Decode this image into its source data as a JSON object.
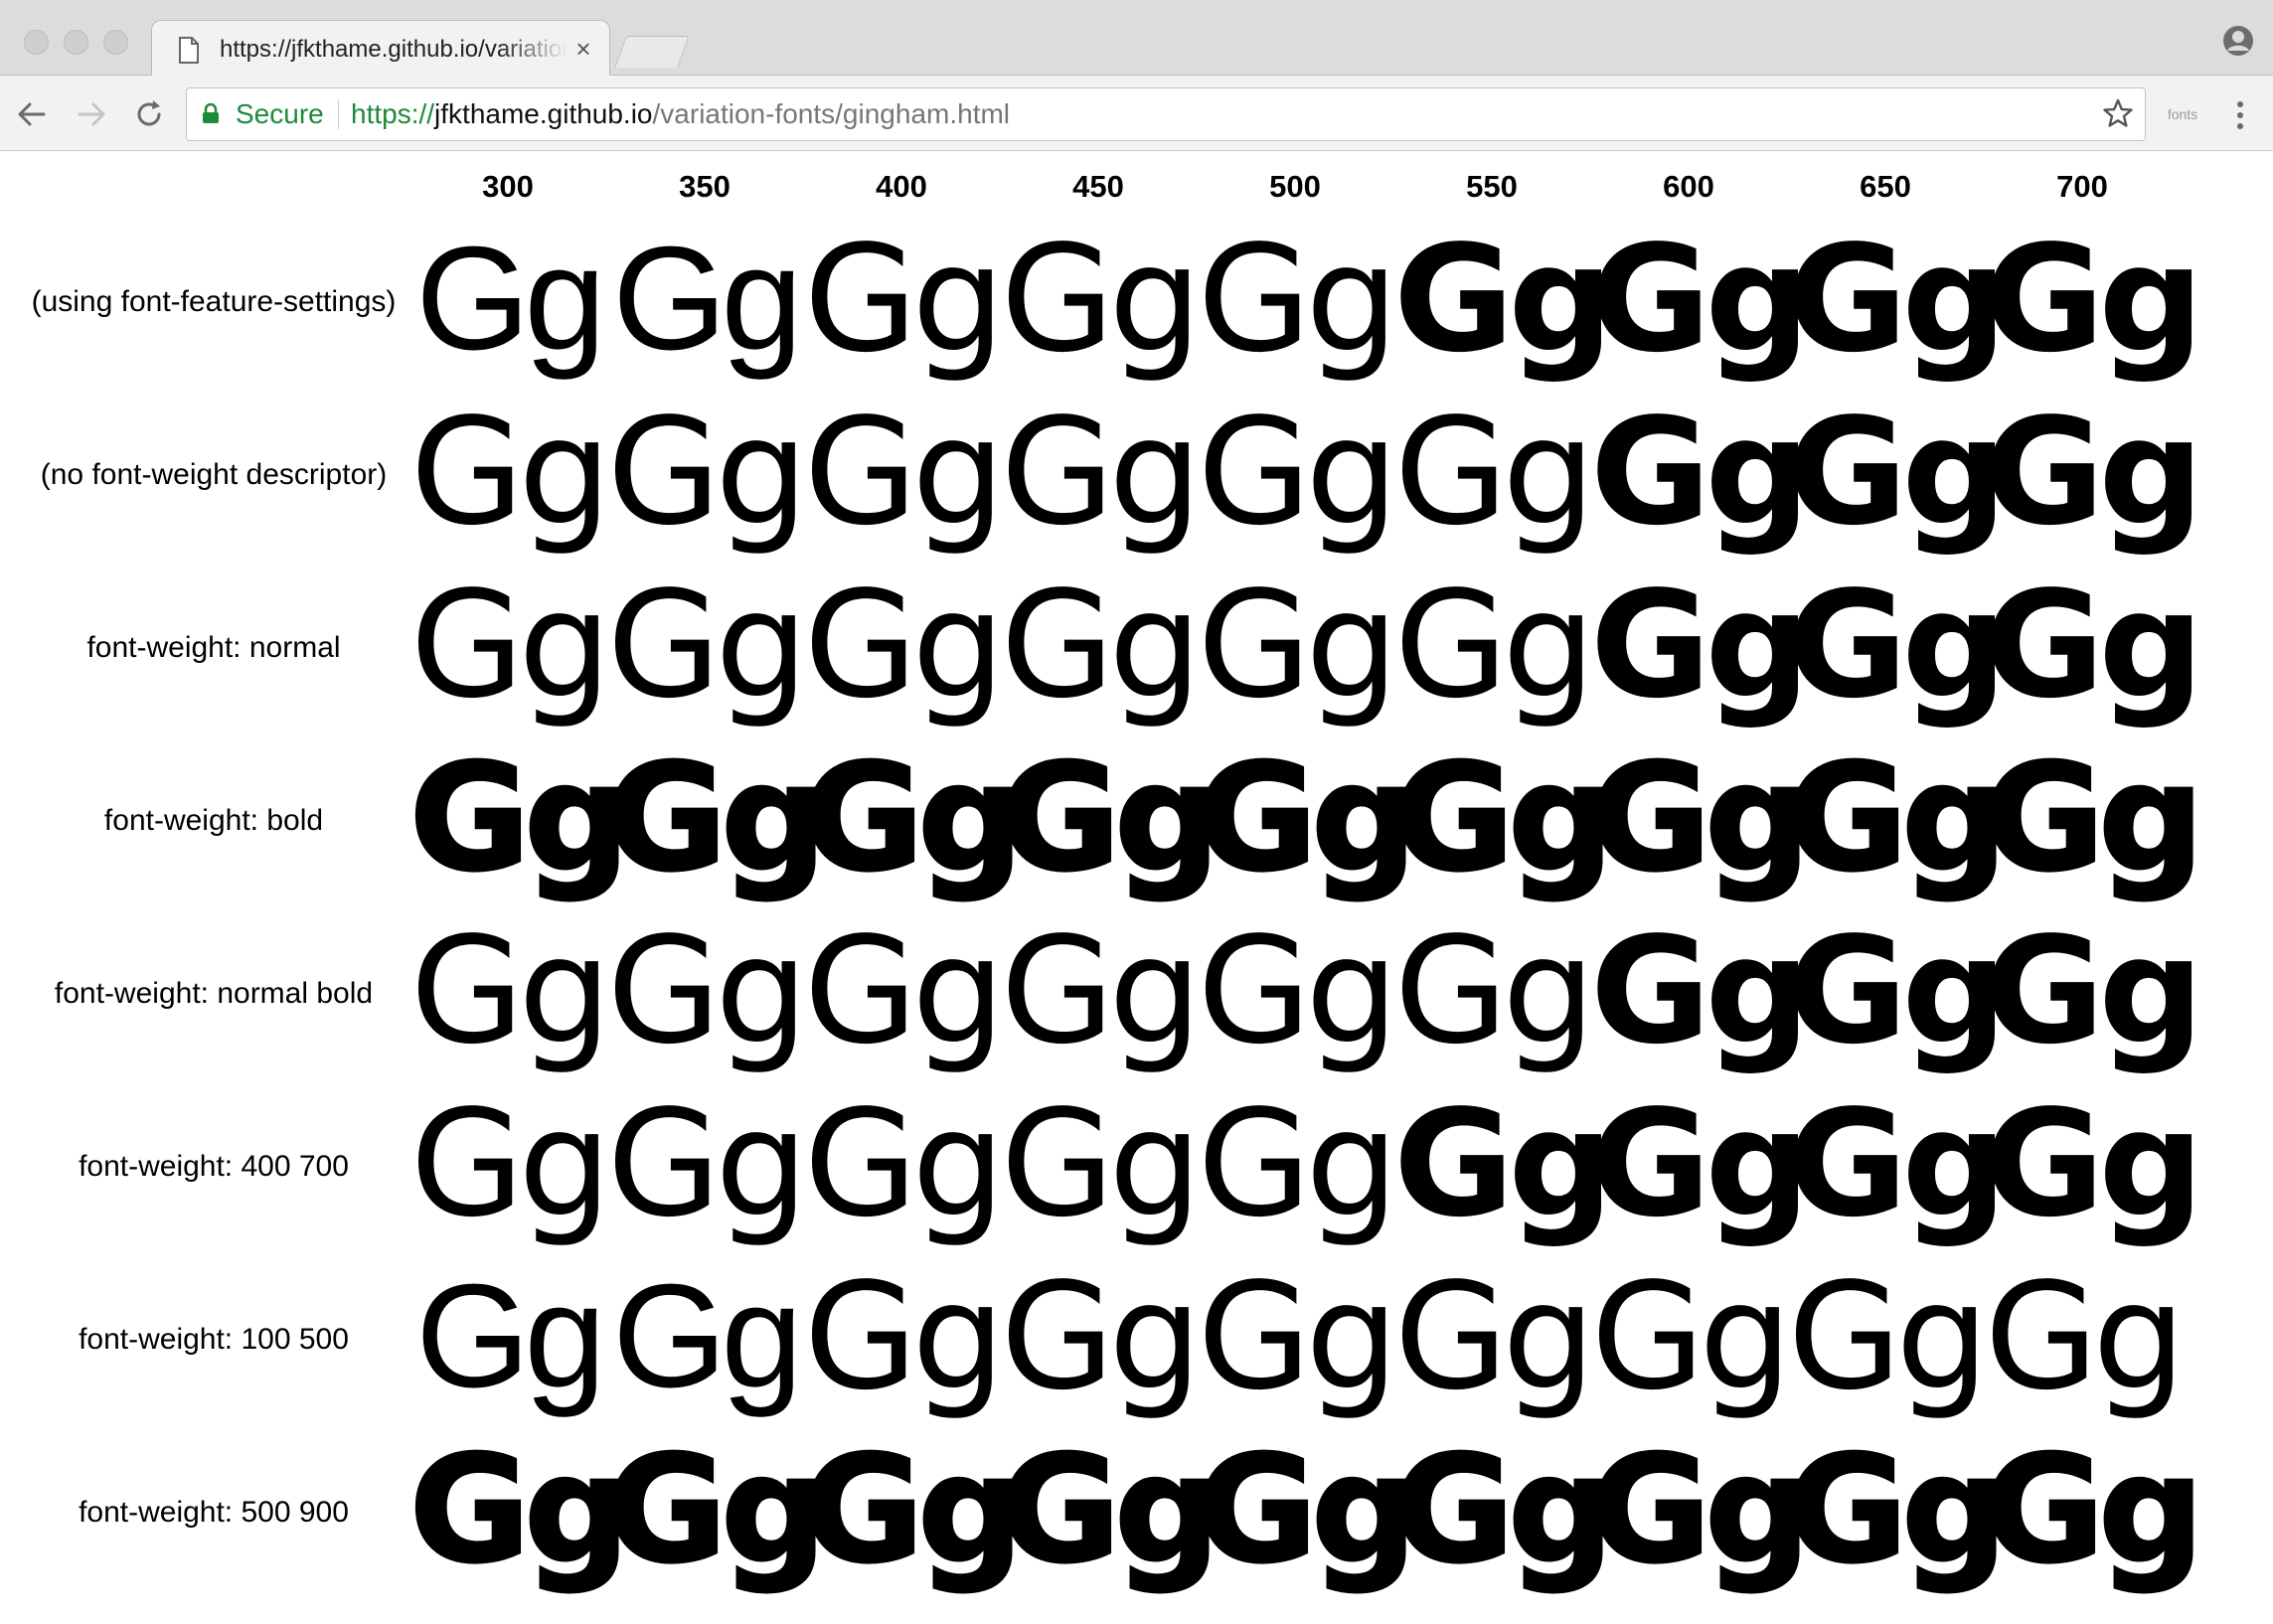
{
  "browser": {
    "tab_title": "https://jfkthame.github.io/variation-fonts/gingham.html",
    "tab_close_icon": "close-icon",
    "security_label": "Secure",
    "url_scheme": "https://",
    "url_host": "jfkthame.github.io",
    "url_path": "/variation-fonts/gingham.html",
    "extension_label": "fonts",
    "secure_color": "#1d8a3c"
  },
  "grid": {
    "columns": [
      "300",
      "350",
      "400",
      "450",
      "500",
      "550",
      "600",
      "650",
      "700"
    ],
    "sample": "Gg",
    "rows": [
      {
        "label": "(using font-feature-settings)",
        "weights": [
          300,
          350,
          400,
          450,
          500,
          550,
          600,
          650,
          700
        ]
      },
      {
        "label": "(no font-weight descriptor)",
        "weights": [
          400,
          400,
          400,
          400,
          400,
          400,
          700,
          700,
          700
        ]
      },
      {
        "label": "font-weight: normal",
        "weights": [
          400,
          400,
          400,
          400,
          400,
          400,
          700,
          700,
          700
        ]
      },
      {
        "label": "font-weight: bold",
        "weights": [
          900,
          900,
          900,
          900,
          900,
          900,
          900,
          900,
          900
        ]
      },
      {
        "label": "font-weight: normal bold",
        "weights": [
          400,
          400,
          400,
          400,
          400,
          400,
          700,
          700,
          700
        ]
      },
      {
        "label": "font-weight: 400 700",
        "weights": [
          400,
          400,
          400,
          450,
          500,
          550,
          600,
          650,
          700
        ]
      },
      {
        "label": "font-weight: 100 500",
        "weights": [
          300,
          350,
          400,
          450,
          500,
          500,
          500,
          500,
          500
        ]
      },
      {
        "label": "font-weight: 500 900",
        "weights": [
          900,
          900,
          900,
          900,
          900,
          900,
          900,
          900,
          900
        ]
      }
    ]
  }
}
